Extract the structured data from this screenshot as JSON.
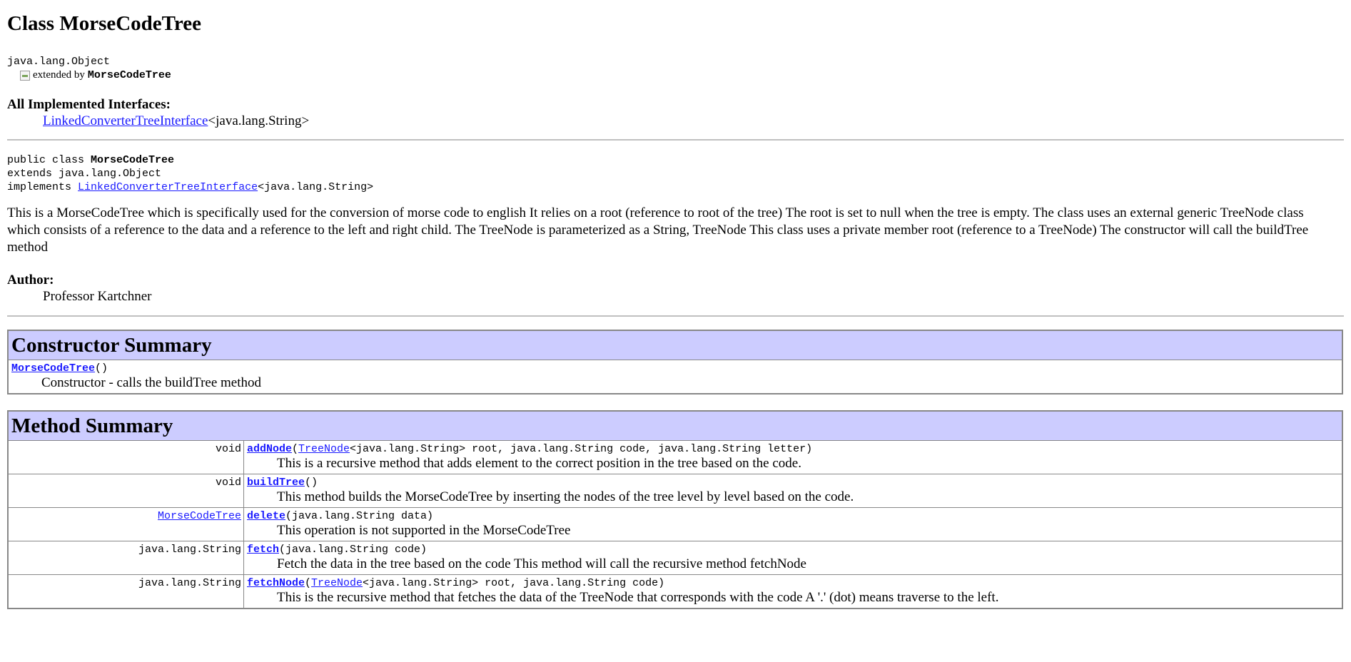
{
  "class_title": "Class MorseCodeTree",
  "hierarchy": {
    "parent": "java.lang.Object",
    "img_alt": "extended by ",
    "child": "MorseCodeTree"
  },
  "interfaces": {
    "label": "All Implemented Interfaces:",
    "link": "LinkedConverterTreeInterface",
    "generic": "<java.lang.String>"
  },
  "declaration": {
    "line1_prefix": "public class ",
    "line1_name": "MorseCodeTree",
    "line2": "extends java.lang.Object",
    "line3_prefix": "implements ",
    "line3_link": "LinkedConverterTreeInterface",
    "line3_suffix": "<java.lang.String>"
  },
  "description": "This is a MorseCodeTree which is specifically used for the conversion of morse code to english It relies on a root (reference to root of the tree) The root is set to null when the tree is empty. The class uses an external generic TreeNode class which consists of a reference to the data and a reference to the left and right child. The TreeNode is parameterized as a String, TreeNode This class uses a private member root (reference to a TreeNode) The constructor will call the buildTree method",
  "author": {
    "label": "Author:",
    "name": "Professor Kartchner"
  },
  "constructor_summary": {
    "title": "Constructor Summary",
    "name": "MorseCodeTree",
    "params": "()",
    "desc": "Constructor - calls the buildTree method"
  },
  "method_summary": {
    "title": "Method Summary",
    "rows": [
      {
        "type": "void",
        "type_is_link": false,
        "name": "addNode",
        "open": "(",
        "param_link": "TreeNode",
        "params": "<java.lang.String> root, java.lang.String code, java.lang.String letter)",
        "desc": "This is a recursive method that adds element to the correct position in the tree based on the code."
      },
      {
        "type": "void",
        "type_is_link": false,
        "name": "buildTree",
        "open": "()",
        "param_link": "",
        "params": "",
        "desc": "This method builds the MorseCodeTree by inserting the nodes of the tree level by level based on the code."
      },
      {
        "type": "MorseCodeTree",
        "type_is_link": true,
        "name": "delete",
        "open": "(java.lang.String data)",
        "param_link": "",
        "params": "",
        "desc": "This operation is not supported in the MorseCodeTree"
      },
      {
        "type": "java.lang.String",
        "type_is_link": false,
        "name": "fetch",
        "open": "(java.lang.String code)",
        "param_link": "",
        "params": "",
        "desc": "Fetch the data in the tree based on the code This method will call the recursive method fetchNode"
      },
      {
        "type": "java.lang.String",
        "type_is_link": false,
        "name": "fetchNode",
        "open": "(",
        "param_link": "TreeNode",
        "params": "<java.lang.String> root, java.lang.String code)",
        "desc": "This is the recursive method that fetches the data of the TreeNode that corresponds with the code A '.' (dot) means traverse to the left."
      }
    ]
  },
  "colors": {
    "link": "#1a1aff",
    "table_header_bg": "#ccccff",
    "rule": "#c0c0c0"
  }
}
